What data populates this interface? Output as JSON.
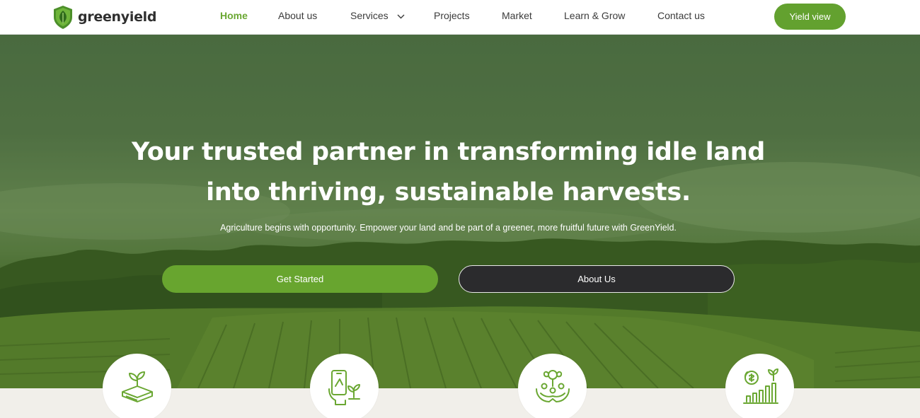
{
  "brand": {
    "name": "greenyield",
    "accent": "#63a12f"
  },
  "nav": {
    "links": [
      {
        "label": "Home",
        "active": true
      },
      {
        "label": "About us"
      },
      {
        "label": "Services",
        "has_dropdown": true
      },
      {
        "label": "Projects"
      },
      {
        "label": "Market"
      },
      {
        "label": "Learn & Grow"
      },
      {
        "label": "Contact us"
      }
    ],
    "cta_label": "Yield view"
  },
  "hero": {
    "title_line1": "Your trusted partner in transforming idle land",
    "title_line2": "into thriving, sustainable harvests.",
    "subtitle": "Agriculture begins with opportunity. Empower your land and be part of a greener, more fruitful future with GreenYield.",
    "primary_button": "Get Started",
    "secondary_button": "About Us"
  },
  "features": [
    {
      "icon": "seedling-box-icon"
    },
    {
      "icon": "phone-plant-icon"
    },
    {
      "icon": "hands-community-plant-icon"
    },
    {
      "icon": "growth-chart-dollar-icon"
    }
  ]
}
